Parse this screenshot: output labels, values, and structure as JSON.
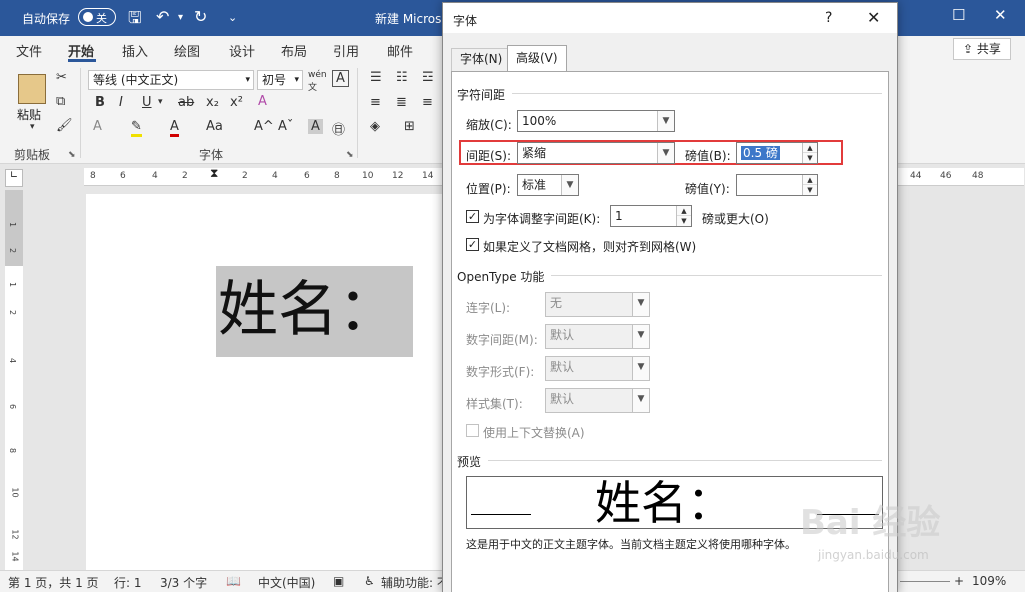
{
  "titlebar": {
    "autosave": "自动保存",
    "toggle_state": "关",
    "doc_title": "新建 Micros"
  },
  "ribbon": {
    "tabs": [
      "文件",
      "开始",
      "插入",
      "绘图",
      "设计",
      "布局",
      "引用",
      "邮件"
    ],
    "share": "共享",
    "paste": "粘贴",
    "font_name": "等线 (中文正文)",
    "font_size": "初号",
    "groups": {
      "clipboard": "剪贴板",
      "font": "字体"
    }
  },
  "document": {
    "text": "姓名：",
    "ruler_top": [
      "8",
      "6",
      "4",
      "2",
      "2",
      "4",
      "6",
      "8",
      "10",
      "12",
      "14",
      "44",
      "46",
      "48"
    ],
    "ruler_left": [
      "1",
      "2",
      "1",
      "2",
      "4",
      "6",
      "8",
      "10",
      "12",
      "14"
    ]
  },
  "statusbar": {
    "page": "第 1 页，共 1 页",
    "row": "行: 1",
    "chars": "3/3 个字",
    "lang": "中文(中国)",
    "accessibility": "辅助功能: 不",
    "zoom": "109%"
  },
  "dialog": {
    "title": "字体",
    "help": "?",
    "close": "✕",
    "tabs": {
      "font": "字体(N)",
      "advanced": "高级(V)"
    },
    "char_spacing": {
      "heading": "字符间距",
      "scale_label": "缩放(C):",
      "scale_value": "100%",
      "spacing_label": "间距(S):",
      "spacing_value": "紧缩",
      "spacing_by_label": "磅值(B):",
      "spacing_by_value": "0.5 磅",
      "position_label": "位置(P):",
      "position_value": "标准",
      "position_by_label": "磅值(Y):",
      "position_by_value": "",
      "kerning_label": "为字体调整字间距(K):",
      "kerning_value": "1",
      "kerning_suffix": "磅或更大(O)",
      "kerning_checked": true,
      "grid_label": "如果定义了文档网格，则对齐到网格(W)",
      "grid_checked": true
    },
    "opentype": {
      "heading": "OpenType 功能",
      "ligatures_label": "连字(L):",
      "ligatures_value": "无",
      "num_spacing_label": "数字间距(M):",
      "num_spacing_value": "默认",
      "num_forms_label": "数字形式(F):",
      "num_forms_value": "默认",
      "style_sets_label": "样式集(T):",
      "style_sets_value": "默认",
      "contextual_label": "使用上下文替换(A)",
      "contextual_checked": false
    },
    "preview": {
      "heading": "预览",
      "text": "姓名：",
      "note": "这是用于中文的正文主题字体。当前文档主题定义将使用哪种字体。"
    }
  },
  "watermark": {
    "main": "Bai 经验",
    "sub": "jingyan.baidu.com"
  },
  "colors": {
    "title_bar": "#2b579a",
    "highlight": "#e23b3b",
    "selection": "#3d78c9"
  }
}
